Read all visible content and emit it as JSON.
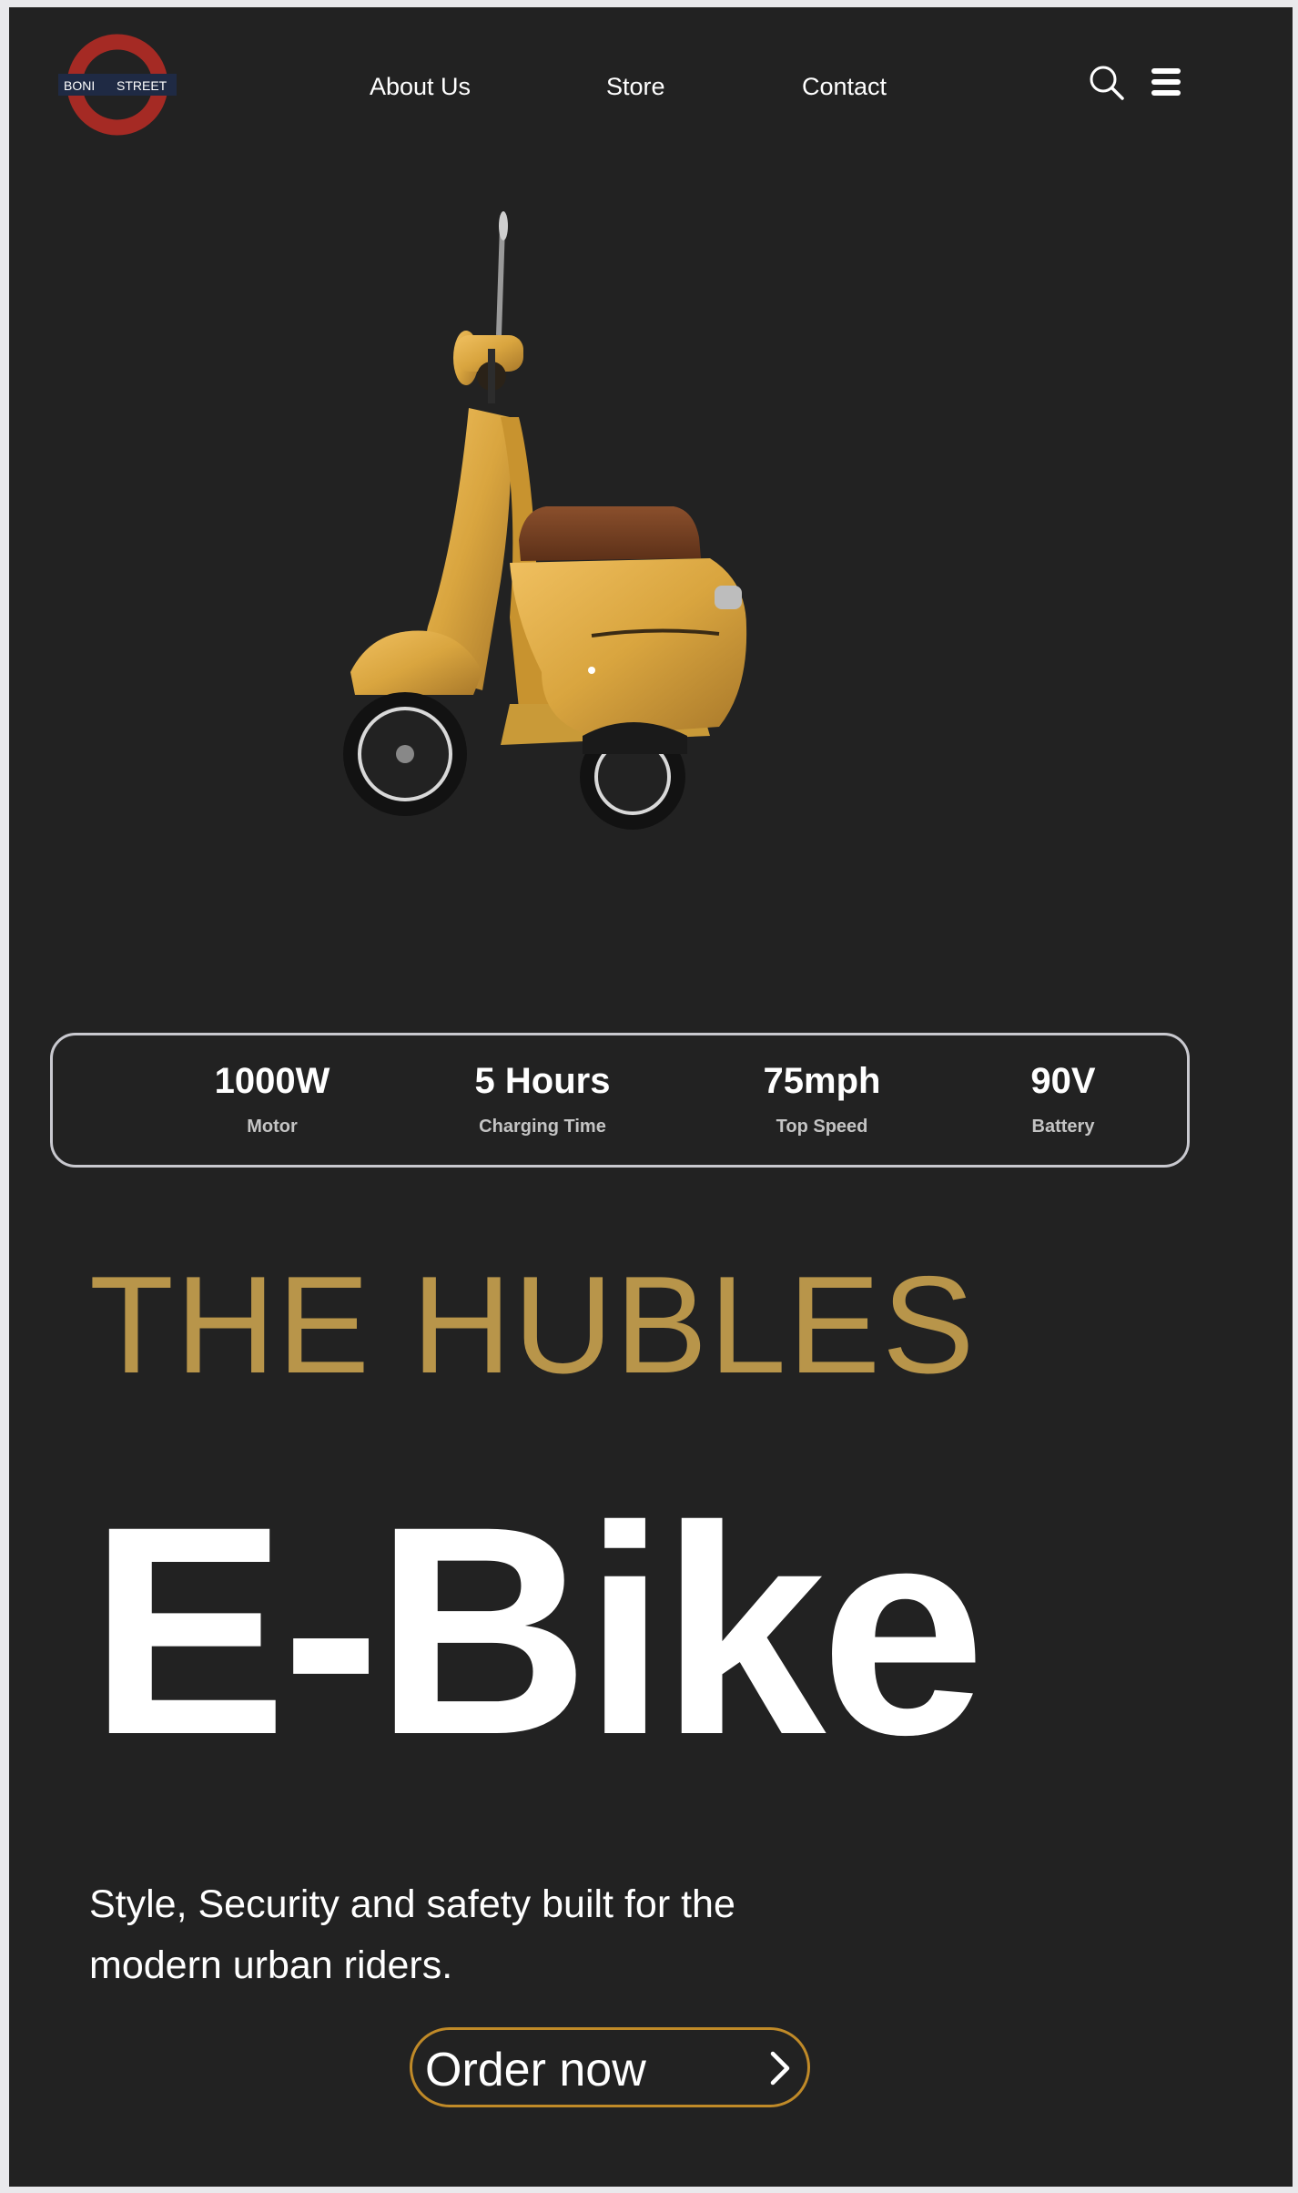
{
  "header": {
    "logo_text_left": "BONI",
    "logo_text_right": "STREET",
    "nav": {
      "about": "About Us",
      "store": "Store",
      "contact": "Contact"
    },
    "icons": [
      "search-icon",
      "menu-icon"
    ]
  },
  "specs": [
    {
      "value": "1000W",
      "label": "Motor"
    },
    {
      "value": "5 Hours",
      "label": "Charging Time"
    },
    {
      "value": "75mph",
      "label": "Top Speed"
    },
    {
      "value": "90V",
      "label": "Battery"
    }
  ],
  "hero": {
    "brand": "THE HUBLES",
    "product": "E-Bike",
    "tagline": "Style, Security and safety built for the modern urban riders.",
    "cta_label": "Order now"
  },
  "colors": {
    "background": "#222222",
    "brand_gold": "#b8954a",
    "button_border": "#c08a28",
    "logo_red": "#a52a24"
  }
}
